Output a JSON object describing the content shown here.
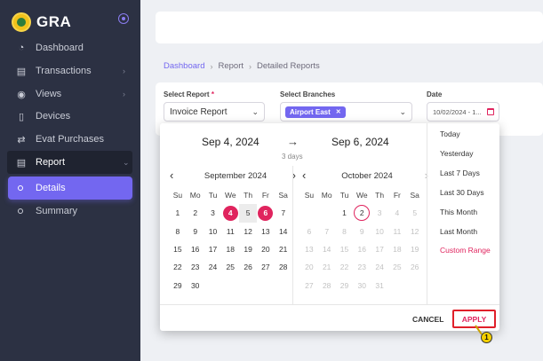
{
  "app": {
    "brand": "GRA"
  },
  "sidebar": {
    "items": [
      {
        "label": "Dashboard",
        "icon": "dashboard-icon",
        "glyph": "◔"
      },
      {
        "label": "Transactions",
        "icon": "transactions-icon",
        "glyph": "▤"
      },
      {
        "label": "Views",
        "icon": "eye-icon",
        "glyph": "◉"
      },
      {
        "label": "Devices",
        "icon": "device-icon",
        "glyph": "▯"
      },
      {
        "label": "Evat Purchases",
        "icon": "swap-icon",
        "glyph": "⇄"
      },
      {
        "label": "Report",
        "icon": "document-icon",
        "glyph": "▤"
      }
    ],
    "subitems": [
      {
        "label": "Details"
      },
      {
        "label": "Summary"
      }
    ]
  },
  "breadcrumb": {
    "root": "Dashboard",
    "section": "Report",
    "current": "Detailed Reports"
  },
  "filters": {
    "report": {
      "label": "Select Report",
      "required": "*",
      "value": "Invoice Report"
    },
    "branches": {
      "label": "Select Branches",
      "tag": "Airport East"
    },
    "date": {
      "label": "Date",
      "value": "10/02/2024 - 1..."
    }
  },
  "picker": {
    "start_label": "Sep 4, 2024",
    "end_label": "Sep 6, 2024",
    "arrow": "→",
    "duration": "3 days",
    "weekdays": [
      "Su",
      "Mo",
      "Tu",
      "We",
      "Th",
      "Fr",
      "Sa"
    ],
    "left": {
      "title": "September 2024",
      "offset": 0,
      "days": 30,
      "selected": [
        4,
        6
      ],
      "in_range": [
        5
      ],
      "today": null,
      "muted_from": 99
    },
    "right": {
      "title": "October 2024",
      "offset": 2,
      "days": 31,
      "selected": [],
      "in_range": [],
      "today": 2,
      "muted_from": 3
    },
    "presets": [
      "Today",
      "Yesterday",
      "Last 7 Days",
      "Last 30 Days",
      "This Month",
      "Last Month",
      "Custom Range"
    ],
    "cancel": "CANCEL",
    "apply": "APPLY"
  },
  "callout": "1",
  "colors": {
    "accent": "#7367f0",
    "danger": "#e0245e",
    "sidebar": "#2c3143"
  }
}
